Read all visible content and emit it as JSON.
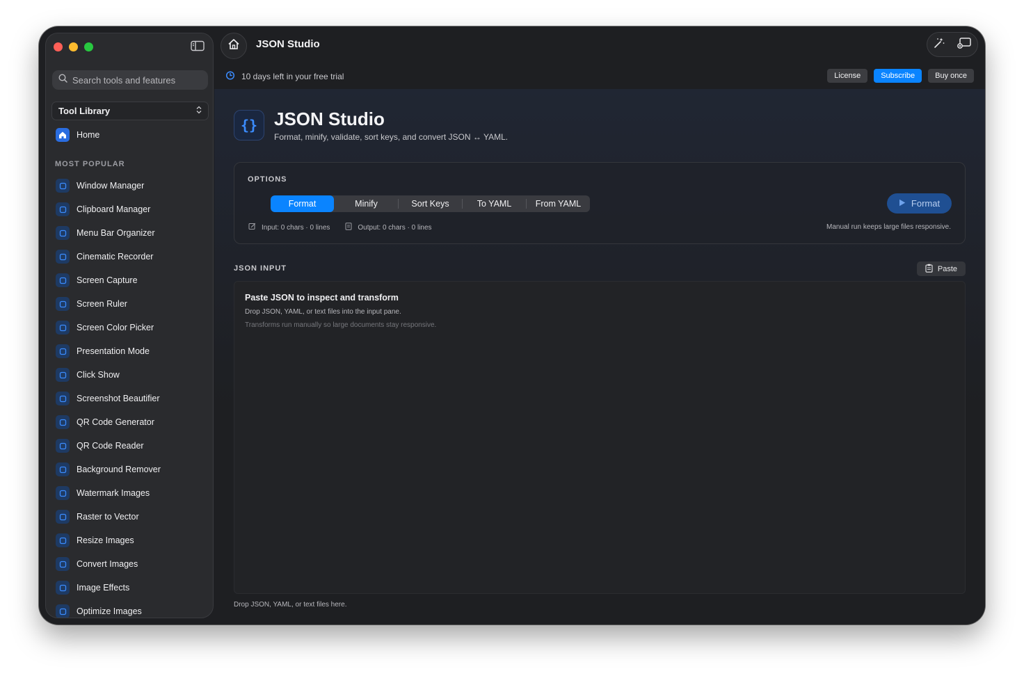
{
  "app": {
    "title": "JSON Studio"
  },
  "sidebar": {
    "search_placeholder": "Search tools and features",
    "library_label": "Tool Library",
    "home_label": "Home",
    "section_label": "MOST POPULAR",
    "tools": [
      {
        "label": "Window Manager",
        "icon": "window-icon"
      },
      {
        "label": "Clipboard Manager",
        "icon": "clipboard-icon"
      },
      {
        "label": "Menu Bar Organizer",
        "icon": "menubar-icon"
      },
      {
        "label": "Cinematic Recorder",
        "icon": "record-icon"
      },
      {
        "label": "Screen Capture",
        "icon": "capture-icon"
      },
      {
        "label": "Screen Ruler",
        "icon": "ruler-icon"
      },
      {
        "label": "Screen Color Picker",
        "icon": "eyedropper-icon"
      },
      {
        "label": "Presentation Mode",
        "icon": "presentation-icon"
      },
      {
        "label": "Click Show",
        "icon": "click-icon"
      },
      {
        "label": "Screenshot Beautifier",
        "icon": "beautify-icon"
      },
      {
        "label": "QR Code Generator",
        "icon": "qr-icon"
      },
      {
        "label": "QR Code Reader",
        "icon": "qr-scan-icon"
      },
      {
        "label": "Background Remover",
        "icon": "background-icon"
      },
      {
        "label": "Watermark Images",
        "icon": "drop-icon"
      },
      {
        "label": "Raster to Vector",
        "icon": "vector-icon"
      },
      {
        "label": "Resize Images",
        "icon": "resize-icon"
      },
      {
        "label": "Convert Images",
        "icon": "convert-icon"
      },
      {
        "label": "Image Effects",
        "icon": "effects-icon"
      },
      {
        "label": "Optimize Images",
        "icon": "optimize-icon"
      }
    ]
  },
  "trial": {
    "text": "10 days left in your free trial",
    "license_label": "License",
    "subscribe_label": "Subscribe",
    "buy_label": "Buy once"
  },
  "page": {
    "icon_text": "{}",
    "title": "JSON Studio",
    "subtitle": "Format, minify, validate, sort keys, and convert JSON ↔ YAML."
  },
  "options": {
    "label": "OPTIONS",
    "modes": [
      "Format",
      "Minify",
      "Sort Keys",
      "To YAML",
      "From YAML"
    ],
    "active_mode": "Format",
    "run_label": "Format",
    "input_stats": "Input: 0 chars · 0 lines",
    "output_stats": "Output: 0 chars · 0 lines",
    "hint": "Manual run keeps large files responsive."
  },
  "input": {
    "label": "JSON INPUT",
    "paste_label": "Paste",
    "empty_title": "Paste JSON to inspect and transform",
    "empty_sub": "Drop JSON, YAML, or text files into the input pane.",
    "empty_note": "Transforms run manually so large documents stay responsive.",
    "drop_hint": "Drop JSON, YAML, or text files here."
  },
  "colors": {
    "accent": "#0a84ff",
    "window_bg": "#1e1f22",
    "sidebar_bg": "#2a2b2e"
  }
}
